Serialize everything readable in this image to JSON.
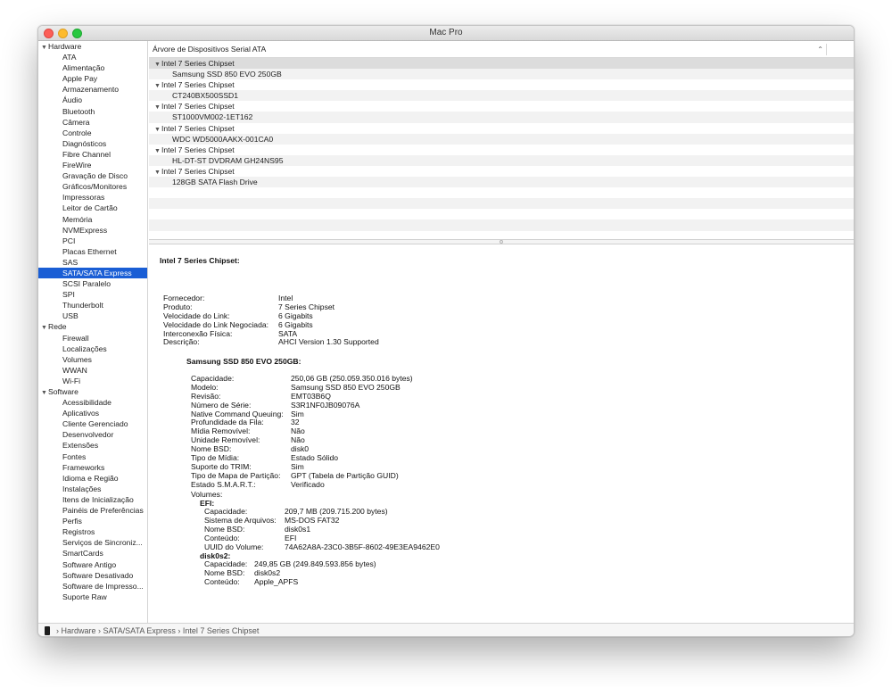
{
  "window_title": "Mac Pro",
  "sidebar": {
    "hardware": {
      "label": "Hardware",
      "items": [
        "ATA",
        "Alimentação",
        "Apple Pay",
        "Armazenamento",
        "Áudio",
        "Bluetooth",
        "Câmera",
        "Controle",
        "Diagnósticos",
        "Fibre Channel",
        "FireWire",
        "Gravação de Disco",
        "Gráficos/Monitores",
        "Impressoras",
        "Leitor de Cartão",
        "Memória",
        "NVMExpress",
        "PCI",
        "Placas Ethernet",
        "SAS",
        "SATA/SATA Express",
        "SCSI Paralelo",
        "SPI",
        "Thunderbolt",
        "USB"
      ]
    },
    "rede": {
      "label": "Rede",
      "items": [
        "Firewall",
        "Localizações",
        "Volumes",
        "WWAN",
        "Wi-Fi"
      ]
    },
    "software": {
      "label": "Software",
      "items": [
        "Acessibilidade",
        "Aplicativos",
        "Cliente Gerenciado",
        "Desenvolvedor",
        "Extensões",
        "Fontes",
        "Frameworks",
        "Idioma e Região",
        "Instalações",
        "Itens de Inicialização",
        "Painéis de Preferências",
        "Perfis",
        "Registros",
        "Serviços de Sincroniz...",
        "SmartCards",
        "Software Antigo",
        "Software Desativado",
        "Software de Impresso...",
        "Suporte Raw"
      ]
    },
    "selected": "SATA/SATA Express"
  },
  "tree": {
    "header": "Árvore de Dispositivos Serial ATA",
    "sort_icon": "chevron-up-icon",
    "rows": [
      {
        "text": "Intel 7 Series Chipset",
        "level": 0,
        "selected": true
      },
      {
        "text": "Samsung SSD 850 EVO 250GB",
        "level": 1
      },
      {
        "text": "Intel 7 Series Chipset",
        "level": 0
      },
      {
        "text": "CT240BX500SSD1",
        "level": 1
      },
      {
        "text": "Intel 7 Series Chipset",
        "level": 0
      },
      {
        "text": "ST1000VM002-1ET162",
        "level": 1
      },
      {
        "text": "Intel 7 Series Chipset",
        "level": 0
      },
      {
        "text": "WDC WD5000AAKX-001CA0",
        "level": 1
      },
      {
        "text": "Intel 7 Series Chipset",
        "level": 0
      },
      {
        "text": "HL-DT-ST DVDRAM GH24NS95",
        "level": 1
      },
      {
        "text": "Intel 7 Series Chipset",
        "level": 0
      },
      {
        "text": "128GB SATA Flash Drive",
        "level": 1
      }
    ]
  },
  "details": {
    "title": "Intel 7 Series Chipset:",
    "controller": [
      [
        "Fornecedor:",
        "Intel"
      ],
      [
        "Produto:",
        "7 Series Chipset"
      ],
      [
        "Velocidade do Link:",
        "6 Gigabits"
      ],
      [
        "Velocidade do Link Negociada:",
        "6 Gigabits"
      ],
      [
        "Interconexão Física:",
        "SATA"
      ],
      [
        "Descrição:",
        "AHCI Version 1.30 Supported"
      ]
    ],
    "device_title": "Samsung SSD 850 EVO 250GB:",
    "device": [
      [
        "Capacidade:",
        "250,06 GB (250.059.350.016 bytes)"
      ],
      [
        "Modelo:",
        "Samsung SSD 850 EVO 250GB"
      ],
      [
        "Revisão:",
        "EMT03B6Q"
      ],
      [
        "Número de Série:",
        "S3R1NF0JB09076A"
      ],
      [
        "Native Command Queuing:",
        "Sim"
      ],
      [
        "Profundidade da Fila:",
        "32"
      ],
      [
        "Mídia Removível:",
        "Não"
      ],
      [
        "Unidade Removível:",
        "Não"
      ],
      [
        "Nome BSD:",
        "disk0"
      ],
      [
        "Tipo de Mídia:",
        "Estado Sólido"
      ],
      [
        "Suporte do TRIM:",
        "Sim"
      ],
      [
        "Tipo de Mapa de Partição:",
        "GPT (Tabela de Partição GUID)"
      ],
      [
        "Estado S.M.A.R.T.:",
        "Verificado"
      ]
    ],
    "volumes_label": "Volumes:",
    "volume1_title": "EFI:",
    "volume1": [
      [
        "Capacidade:",
        "209,7 MB (209.715.200 bytes)"
      ],
      [
        "Sistema de Arquivos:",
        "MS-DOS FAT32"
      ],
      [
        "Nome BSD:",
        "disk0s1"
      ],
      [
        "Conteúdo:",
        "EFI"
      ],
      [
        "UUID do Volume:",
        "74A62A8A-23C0-3B5F-8602-49E3EA9462E0"
      ]
    ],
    "volume2_title": "disk0s2:",
    "volume2": [
      [
        "Capacidade:",
        "249,85 GB (249.849.593.856 bytes)"
      ],
      [
        "Nome BSD:",
        "disk0s2"
      ],
      [
        "Conteúdo:",
        "Apple_APFS"
      ]
    ]
  },
  "statusbar": {
    "icon": "mac-pro-icon",
    "path": "› Hardware › SATA/SATA Express › Intel 7 Series Chipset"
  },
  "colors": {
    "selection": "#1a5ed5",
    "close": "#fc5f57",
    "minimize": "#fdbb2e",
    "maximize": "#28c840"
  }
}
